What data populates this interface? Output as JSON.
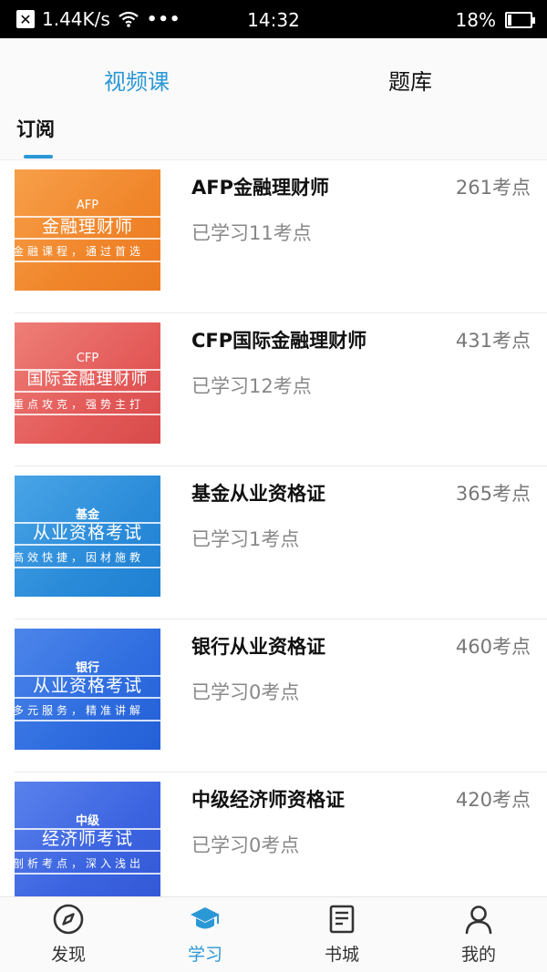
{
  "status_bar": {
    "speed": "1.44K/s",
    "dots": "•••",
    "time": "14:32",
    "battery": "18%",
    "battery_level": 0.18
  },
  "top_tabs": [
    {
      "label": "视频课",
      "active": true
    },
    {
      "label": "题库",
      "active": false
    }
  ],
  "sub_tab": {
    "label": "订阅"
  },
  "courses": [
    {
      "title": "AFP金融理财师",
      "count": "261考点",
      "progress": "已学习11考点",
      "thumb": {
        "small": "AFP",
        "big": "金融理财师",
        "slogan": "金融课程，通过首选",
        "color": "#f28a30"
      }
    },
    {
      "title": "CFP国际金融理财师",
      "count": "431考点",
      "progress": "已学习12考点",
      "thumb": {
        "small": "CFP",
        "big": "国际金融理财师",
        "slogan": "重点攻克，强势主打",
        "color": "#e8605f"
      }
    },
    {
      "title": "基金从业资格证",
      "count": "365考点",
      "progress": "已学习1考点",
      "thumb": {
        "small": "基金",
        "big": "从业资格考试",
        "slogan": "高效快捷，因材施教",
        "color": "#2d8fdc"
      }
    },
    {
      "title": "银行从业资格证",
      "count": "460考点",
      "progress": "已学习0考点",
      "thumb": {
        "small": "银行",
        "big": "从业资格考试",
        "slogan": "多元服务，精准讲解",
        "color": "#2f6fe0"
      }
    },
    {
      "title": "中级经济师资格证",
      "count": "420考点",
      "progress": "已学习0考点",
      "thumb": {
        "small": "中级",
        "big": "经济师考试",
        "slogan": "剖析考点，深入浅出",
        "color": "#3c66e2"
      }
    }
  ],
  "bottom_nav": [
    {
      "label": "发现",
      "icon": "compass-icon",
      "active": false
    },
    {
      "label": "学习",
      "icon": "graduation-cap-icon",
      "active": true
    },
    {
      "label": "书城",
      "icon": "book-icon",
      "active": false
    },
    {
      "label": "我的",
      "icon": "person-icon",
      "active": false
    }
  ],
  "colors": {
    "accent": "#2b98d6"
  }
}
